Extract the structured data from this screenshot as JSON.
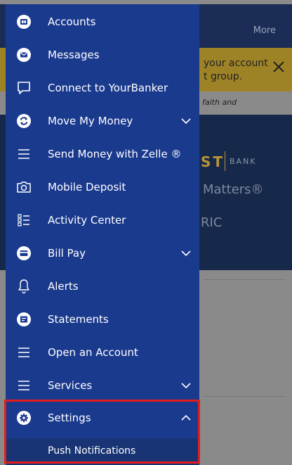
{
  "background": {
    "header_more": "More",
    "banner_text": "your account\nt group.",
    "tagline": "faith  and",
    "logo_main": "ST",
    "logo_bank": "BANK",
    "slogan": "Matters®",
    "ric": "RIC"
  },
  "colors": {
    "drawer": "#1a3a8e",
    "highlight": "#e41c1c",
    "hero": "#17294a",
    "banner": "#9e8326"
  },
  "menu": {
    "items": [
      {
        "label": "Accounts",
        "icon": "accounts-icon"
      },
      {
        "label": "Messages",
        "icon": "messages-icon"
      },
      {
        "label": "Connect to YourBanker",
        "icon": "chat-bubble-icon"
      },
      {
        "label": "Move My Money",
        "icon": "transfer-icon",
        "expandable": true
      },
      {
        "label": "Send Money with Zelle ®",
        "icon": "hamburger-icon"
      },
      {
        "label": "Mobile Deposit",
        "icon": "camera-icon"
      },
      {
        "label": "Activity Center",
        "icon": "list-icon"
      },
      {
        "label": "Bill Pay",
        "icon": "bill-pay-icon",
        "expandable": true
      },
      {
        "label": "Alerts",
        "icon": "bell-icon"
      },
      {
        "label": "Statements",
        "icon": "statements-icon"
      },
      {
        "label": "Open an Account",
        "icon": "hamburger-icon"
      },
      {
        "label": "Services",
        "icon": "hamburger-icon",
        "expandable": true
      },
      {
        "label": "Settings",
        "icon": "gear-icon",
        "expandable": true,
        "expanded": true
      }
    ],
    "settings_sub": {
      "label": "Push Notifications"
    }
  }
}
